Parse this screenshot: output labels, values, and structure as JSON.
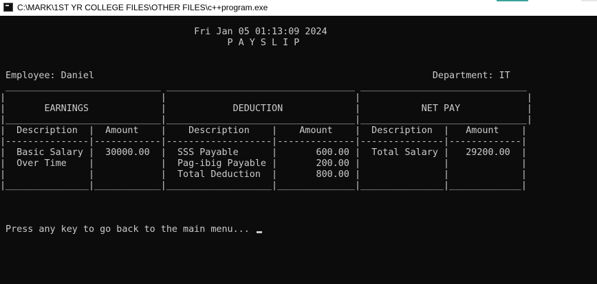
{
  "window": {
    "title": "C:\\MARK\\1ST YR COLLEGE FILES\\OTHER FILES\\c++program.exe"
  },
  "console": {
    "lines": [
      "",
      "                                   Fri Jan 05 01:13:09 2024",
      "                                         P A Y S L I P",
      "",
      "",
      " Employee: Daniel                                                             Department: IT",
      " ____________________________ __________________________________ ______________________________",
      "|                            |                                  |                              |",
      "|       EARNINGS             |            DEDUCTION             |           NET PAY            |",
      "|____________________________|__________________________________|______________________________|",
      "|  Description  |  Amount    |    Description    |    Amount    |  Description  |   Amount    |",
      "|---------------|------------|-------------------|--------------|---------------|-------------|",
      "|  Basic Salary |  30000.00  |  SSS Payable      |       600.00 |  Total Salary |   29200.00  |",
      "|  Over Time    |            |  Pag-ibig Payable |       200.00 |               |             |",
      "|               |            |  Total Deduction  |       800.00 |               |             |",
      "|_______________|____________|___________________|______________|_______________|_____________|",
      "",
      "",
      "",
      " Press any key to go back to the main menu... "
    ]
  }
}
